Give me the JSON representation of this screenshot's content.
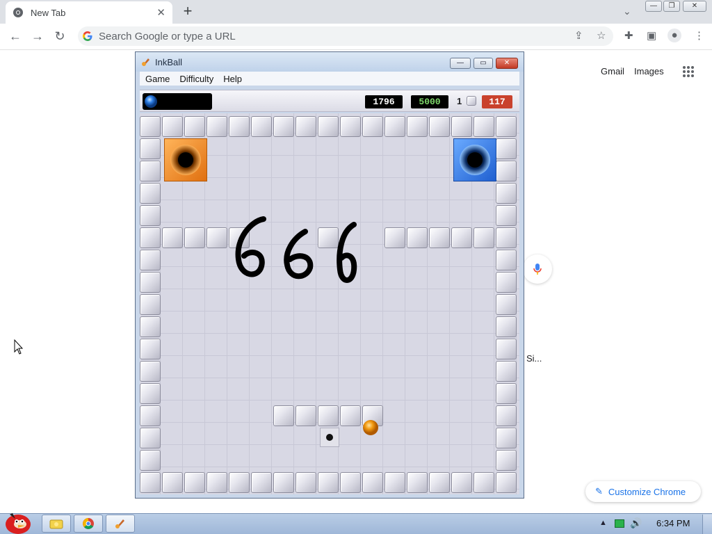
{
  "browser": {
    "tab_title": "New Tab",
    "tab_close": "✕",
    "new_tab": "+",
    "omnibox_placeholder": "Search Google or type a URL",
    "window_min": "—",
    "window_max": "❐",
    "window_close": "✕"
  },
  "ntp": {
    "gmail": "Gmail",
    "images": "Images",
    "shortcut_fragment": "Si...",
    "customize": "Customize Chrome"
  },
  "inkball": {
    "title": "InkBall",
    "menu": [
      "Game",
      "Difficulty",
      "Help"
    ],
    "score": "1796",
    "target": "5000",
    "lives": "1",
    "timer": "117",
    "ink_text": "666",
    "colors": {
      "score_bg": "#000000",
      "target_text": "#7fd96b",
      "timer_bg": "#c9412c",
      "orange_hole": "#f08a22",
      "blue_hole": "#2f7fe6",
      "ball": "#f29a12"
    }
  },
  "taskbar": {
    "clock": "6:34 PM"
  },
  "icons": {
    "tab_favicon": "chrome-icon",
    "share": "share-icon",
    "star": "star-icon",
    "extensions": "puzzle-icon",
    "sidepanel": "side-panel-icon",
    "profile": "profile-icon",
    "menu": "kebab-menu-icon"
  }
}
